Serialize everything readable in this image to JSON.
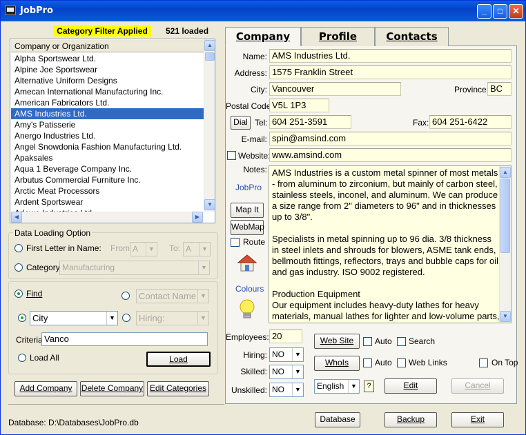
{
  "window": {
    "title": "JobPro"
  },
  "left": {
    "filter_badge": "Category Filter Applied",
    "loaded_count": "521 loaded",
    "list": {
      "header": "Company or Organization",
      "items": [
        "Alpha Sportswear Ltd.",
        "Alpine Joe Sportswear",
        "Alternative Uniform Designs",
        "Amecan International Manufacturing Inc.",
        "American Fabricators Ltd.",
        "AMS Industries Ltd.",
        "Amy's Patisserie",
        "Anergo Industries Ltd.",
        "Angel Snowdonia Fashion Manufacturing Ltd.",
        "Apaksales",
        "Aqua 1 Beverage Company Inc.",
        "Arbutus Commercial Furniture Inc.",
        "Arctic Meat Processors",
        "Ardent Sportswear",
        "Arlowe Industries Ltd."
      ],
      "selected_index": 5
    },
    "data_loading": {
      "group_label": "Data Loading Option",
      "first_letter_label": "First Letter in Name:",
      "from_label": "From:",
      "from_value": "A",
      "to_label": "To:",
      "to_value": "A",
      "category_label": "Category:",
      "category_value": "Manufacturing"
    },
    "find": {
      "find_label": "Find",
      "contact_name_value": "Contact Name",
      "field_value": "City",
      "hiring_value": "Hiring:",
      "criteria_label": "Criteria:",
      "criteria_value": "Vanco",
      "load_all_label": "Load All",
      "load_button": "Load"
    },
    "buttons": {
      "add": "Add Company",
      "delete": "Delete Company",
      "edit_categories": "Edit Categories"
    },
    "database_path": "Database: D:\\Databases\\JobPro.db"
  },
  "tabs": [
    "Company",
    "Profile",
    "Contacts"
  ],
  "company": {
    "name_label": "Name:",
    "name": "AMS Industries Ltd.",
    "address_label": "Address:",
    "address": "1575 Franklin Street",
    "city_label": "City:",
    "city": "Vancouver",
    "province_label": "Province:",
    "province": "BC",
    "postal_label": "Postal Code:",
    "postal": "V5L 1P3",
    "dial_button": "Dial",
    "tel_label": "Tel:",
    "tel": "604 251-3591",
    "fax_label": "Fax:",
    "fax": "604 251-6422",
    "email_label": "E-mail:",
    "email": "spin@amsind.com",
    "website_label": "Website:",
    "website": "www.amsind.com",
    "notes_label": "Notes:",
    "notes": "AMS Industries is a custom metal spinner of most metals - from aluminum to zirconium, but mainly of carbon steel, stainless steels, inconel, and aluminum. We can produce a size range from 2\" diameters to 96\" and in thicknesses up to 3/8\".\n\nSpecialists in metal spinning up to 96 dia. 3/8 thickness in steel inlets and shrouds for blowers, ASME tank ends, bellmouth fittings, reflectors, trays and bubble caps for oil and gas industry. ISO 9002 registered.\n\nProduction Equipment\nOur equipment includes heavy-duty lathes for heavy materials, manual lathes for lighter and low-volume parts,",
    "jobpro_label": "JobPro",
    "mapit_button": "Map It",
    "webmap_button": "WebMap",
    "route_label": "Route",
    "colours_label": "Colours",
    "employees_label": "Employees:",
    "employees": "20",
    "hiring_label": "Hiring:",
    "hiring": "NO",
    "skilled_label": "Skilled:",
    "skilled": "NO",
    "unskilled_label": "Unskilled:",
    "unskilled": "NO",
    "website_button": "Web Site",
    "whois_button": "WhoIs",
    "auto_label": "Auto",
    "search_label": "Search",
    "weblinks_label": "Web Links",
    "ontop_label": "On Top",
    "language": "English",
    "help_icon_text": "?",
    "edit_button": "Edit",
    "cancel_button": "Cancel"
  },
  "bottom": {
    "database_button": "Database",
    "backup_button": "Backup",
    "exit_button": "Exit"
  },
  "colors": {
    "title_bar": "#0a5fe8",
    "selection": "#316ac5",
    "field_bg": "#FFFFE1",
    "badge": "#FFFF00"
  }
}
